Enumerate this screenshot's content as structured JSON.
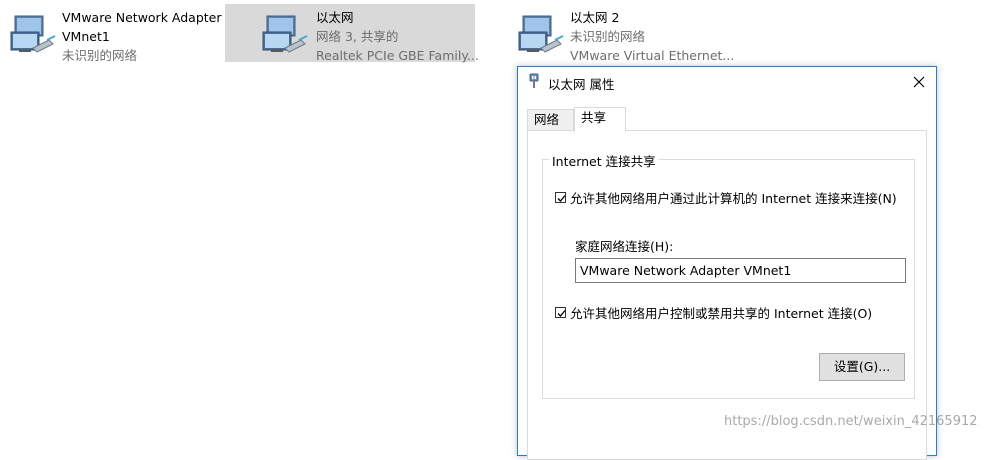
{
  "adapters": [
    {
      "name": "VMware Network Adapter",
      "name2": "VMnet1",
      "status": "未识别的网络",
      "selected": false
    },
    {
      "name": "以太网",
      "status": "网络 3, 共享的",
      "device": "Realtek PCIe GBE Family...",
      "selected": true
    },
    {
      "name": "以太网 2",
      "status": "未识别的网络",
      "device": "VMware Virtual Ethernet...",
      "selected": false
    }
  ],
  "dialog": {
    "title": "以太网 属性",
    "tabs": [
      {
        "label": "网络",
        "active": false
      },
      {
        "label": "共享",
        "active": true
      }
    ],
    "group_title": "Internet 连接共享",
    "allow_share_label": "允许其他网络用户通过此计算机的 Internet 连接来连接(N)",
    "allow_share_checked": true,
    "home_conn_label": "家庭网络连接(H):",
    "home_conn_value": "VMware Network Adapter VMnet1",
    "allow_control_label": "允许其他网络用户控制或禁用共享的 Internet 连接(O)",
    "allow_control_checked": true,
    "settings_button": "设置(G)..."
  },
  "watermark": "https://blog.csdn.net/weixin_42165912",
  "icons": {
    "adapter": "network-adapter-icon",
    "title": "network-plug-icon",
    "close": "close-icon",
    "check": "checkmark-icon"
  },
  "colors": {
    "selected_tile": "#d9d9d9",
    "dialog_border": "#2b7bd4",
    "secondary_text": "#6d6d6d"
  }
}
